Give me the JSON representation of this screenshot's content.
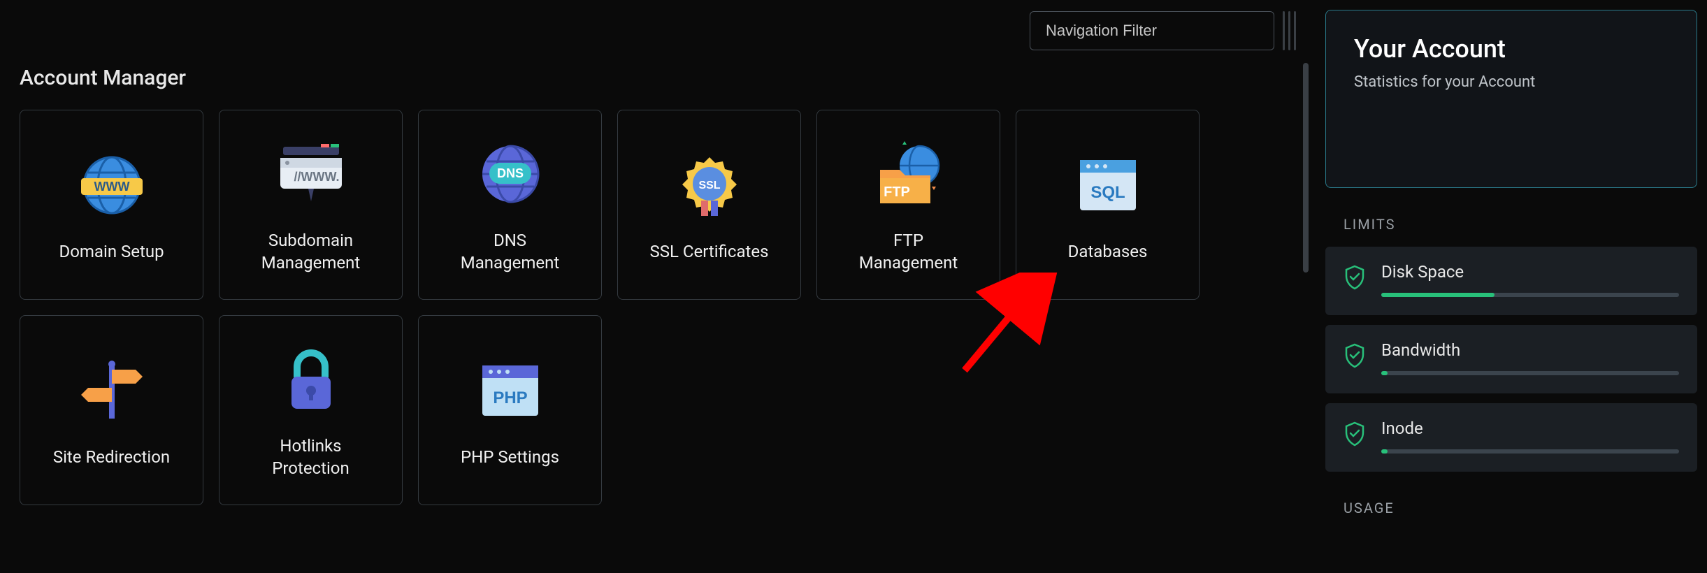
{
  "nav_filter_placeholder": "Navigation Filter",
  "section_title": "Account Manager",
  "cards": {
    "domain_setup": "Domain Setup",
    "subdomain_management": "Subdomain\nManagement",
    "dns_management": "DNS\nManagement",
    "ssl_certificates": "SSL Certificates",
    "ftp_management": "FTP\nManagement",
    "databases": "Databases",
    "site_redirection": "Site Redirection",
    "hotlinks_protection": "Hotlinks\nProtection",
    "php_settings": "PHP Settings"
  },
  "sidebar": {
    "title": "Your Account",
    "subtitle": "Statistics for your Account",
    "limits_heading": "LIMITS",
    "usage_heading": "USAGE",
    "limits": {
      "disk_space": {
        "label": "Disk Space",
        "percent": 38
      },
      "bandwidth": {
        "label": "Bandwidth",
        "percent": 2
      },
      "inode": {
        "label": "Inode",
        "percent": 2
      }
    }
  }
}
